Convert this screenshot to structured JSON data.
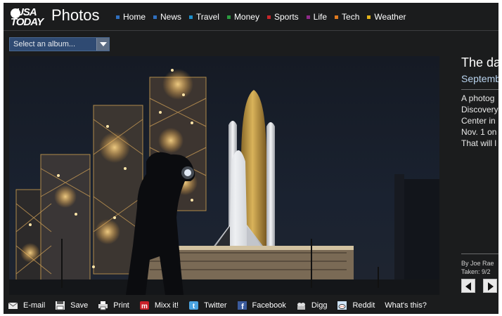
{
  "header": {
    "logo_line1": "USA",
    "logo_line2": "TODAY",
    "section_title": "Photos"
  },
  "nav": [
    {
      "label": "Home",
      "color": "#2f6fbf"
    },
    {
      "label": "News",
      "color": "#2f6fbf"
    },
    {
      "label": "Travel",
      "color": "#1e8fc9"
    },
    {
      "label": "Money",
      "color": "#2b9c3f"
    },
    {
      "label": "Sports",
      "color": "#c9262a"
    },
    {
      "label": "Life",
      "color": "#8f2a8a"
    },
    {
      "label": "Tech",
      "color": "#e07a1f"
    },
    {
      "label": "Weather",
      "color": "#e2b21a"
    }
  ],
  "album_select": {
    "value": "Select an album..."
  },
  "photo": {
    "subject": "space shuttle Discovery on launch pad at night with silhouetted worker"
  },
  "story": {
    "headline": "The da",
    "date": "Septemb",
    "caption_lines": [
      "A photog",
      "Discovery",
      "Center in",
      "Nov. 1 on",
      "That will l"
    ],
    "credit": "By Joe Rae",
    "taken": "Taken: 9/2"
  },
  "share": [
    {
      "label": "E-mail",
      "icon": "mail-icon"
    },
    {
      "label": "Save",
      "icon": "save-icon"
    },
    {
      "label": "Print",
      "icon": "print-icon"
    },
    {
      "label": "Mixx it!",
      "icon": "mixx-icon"
    },
    {
      "label": "Twitter",
      "icon": "twitter-icon"
    },
    {
      "label": "Facebook",
      "icon": "facebook-icon"
    },
    {
      "label": "Digg",
      "icon": "digg-icon"
    },
    {
      "label": "Reddit",
      "icon": "reddit-icon"
    },
    {
      "label": "What's this?",
      "icon": ""
    }
  ]
}
